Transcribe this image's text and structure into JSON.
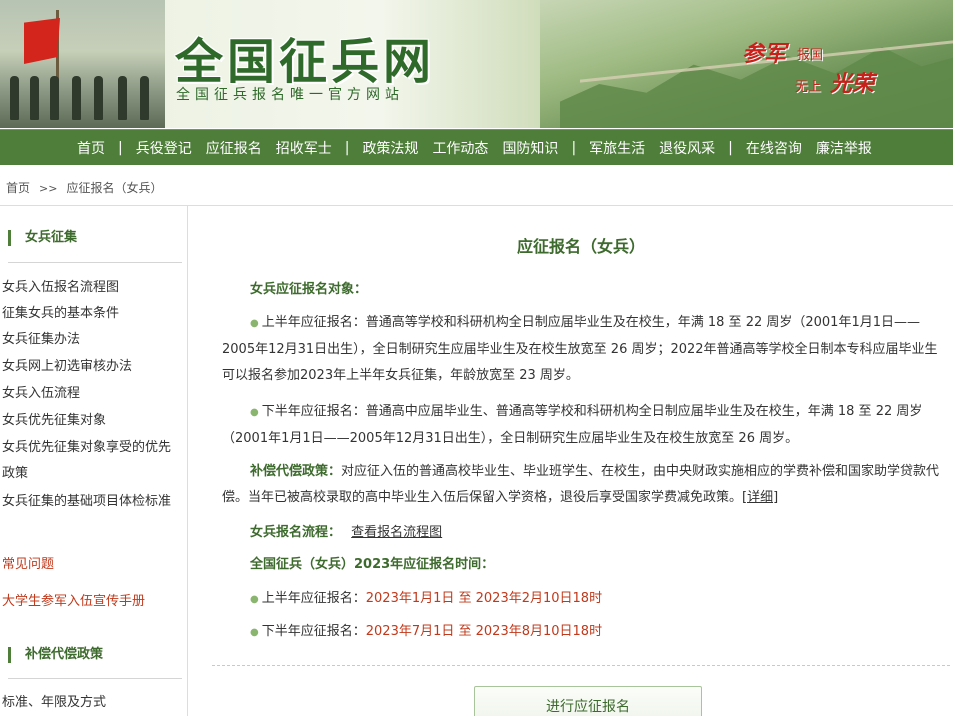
{
  "banner": {
    "site_title": "全国征兵网",
    "site_subtitle": "全国征兵报名唯一官方网站",
    "slogan_join": "参军",
    "slogan_country": "报国",
    "slogan_supreme": "无上",
    "slogan_glory": "光荣"
  },
  "nav": {
    "items": [
      "首页",
      "兵役登记",
      "应征报名",
      "招收军士",
      "政策法规",
      "工作动态",
      "国防知识",
      "军旅生活",
      "退役风采",
      "在线咨询",
      "廉洁举报"
    ],
    "separator": "|"
  },
  "breadcrumb": {
    "home": "首页",
    "arrow": ">>",
    "current": "应征报名（女兵）"
  },
  "sidebar": {
    "section1_title": "女兵征集",
    "section1_links": [
      "女兵入伍报名流程图",
      "征集女兵的基本条件",
      "女兵征集办法",
      "女兵网上初选审核办法",
      "女兵入伍流程",
      "女兵优先征集对象",
      "女兵优先征集对象享受的优先政策",
      "女兵征集的基础项目体检标准"
    ],
    "faq": "常见问题",
    "handbook": "大学生参军入伍宣传手册",
    "section2_title": "补偿代偿政策",
    "section2_links": [
      "标准、年限及方式"
    ]
  },
  "main": {
    "title": "应征报名（女兵）",
    "targets_heading": "女兵应征报名对象：",
    "first_half_label": "上半年应征报名：",
    "first_half_text": "普通高等学校和科研机构全日制应届毕业生及在校生，年满 18 至 22 周岁（2001年1月1日——2005年12月31日出生），全日制研究生应届毕业生及在校生放宽至 26 周岁；2022年普通高等学校全日制本专科应届毕业生可以报名参加2023年上半年女兵征集，年龄放宽至 23 周岁。",
    "second_half_label": "下半年应征报名：",
    "second_half_text": "普通高中应届毕业生、普通高等学校和科研机构全日制应届毕业生及在校生，年满 18 至 22 周岁（2001年1月1日——2005年12月31日出生），全日制研究生应届毕业生及在校生放宽至 26 周岁。",
    "compensation_label": "补偿代偿政策：",
    "compensation_text": "对应征入伍的普通高校毕业生、毕业班学生、在校生，由中央财政实施相应的学费补偿和国家助学贷款代偿。当年已被高校录取的高中毕业生入伍后保留入学资格，退役后享受国家学费减免政策。",
    "details_link": "[详细]",
    "process_label": "女兵报名流程：",
    "process_link": "查看报名流程图",
    "schedule_heading": "全国征兵（女兵）2023年应征报名时间：",
    "first_half_time_label": "上半年应征报名：",
    "first_half_time": "2023年1月1日 至 2023年2月10日18时",
    "second_half_time_label": "下半年应征报名：",
    "second_half_time": "2023年7月1日 至 2023年8月10日18时",
    "apply_button": "进行应征报名"
  },
  "colors": {
    "nav_bg": "#4f7e3b",
    "title_green": "#3d6a2d",
    "accent_red": "#c0391b"
  }
}
